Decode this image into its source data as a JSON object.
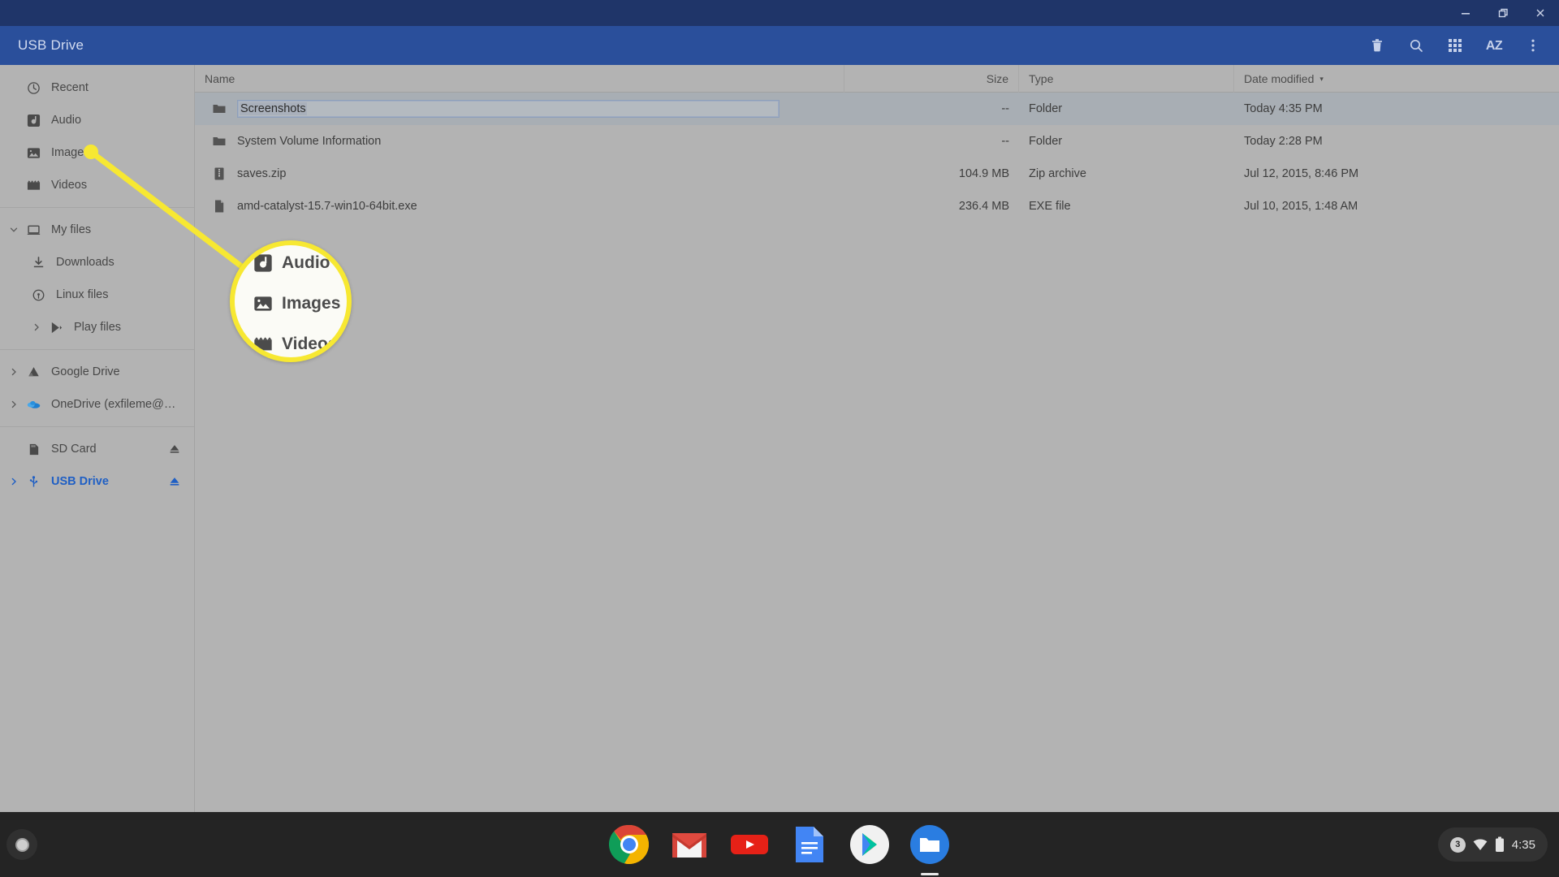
{
  "window": {
    "minimize_label": "Minimize",
    "restore_label": "Restore",
    "close_label": "Close"
  },
  "appbar": {
    "title": "USB Drive",
    "actions": [
      {
        "name": "delete-icon",
        "label": "Delete"
      },
      {
        "name": "search-icon",
        "label": "Search"
      },
      {
        "name": "grid-view-icon",
        "label": "Switch to thumbnail view"
      },
      {
        "name": "sort-az-icon",
        "label": "AZ"
      },
      {
        "name": "more-vert-icon",
        "label": "More…"
      }
    ],
    "az_text": "AZ"
  },
  "sidebar": {
    "groups": [
      {
        "items": [
          {
            "label": "Recent",
            "icon": "clock-icon",
            "twisty": "",
            "indent": false,
            "active": false,
            "eject": false
          },
          {
            "label": "Audio",
            "icon": "audio-icon",
            "twisty": "",
            "indent": false,
            "active": false,
            "eject": false
          },
          {
            "label": "Images",
            "icon": "image-icon",
            "twisty": "",
            "indent": false,
            "active": false,
            "eject": false
          },
          {
            "label": "Videos",
            "icon": "video-icon",
            "twisty": "",
            "indent": false,
            "active": false,
            "eject": false
          }
        ]
      },
      {
        "items": [
          {
            "label": "My files",
            "icon": "computer-icon",
            "twisty": "down",
            "indent": false,
            "active": false,
            "eject": false
          },
          {
            "label": "Downloads",
            "icon": "download-icon",
            "twisty": "",
            "indent": true,
            "active": false,
            "eject": false
          },
          {
            "label": "Linux files",
            "icon": "linux-icon",
            "twisty": "",
            "indent": true,
            "active": false,
            "eject": false
          },
          {
            "label": "Play files",
            "icon": "play-icon",
            "twisty": "right",
            "indent": true,
            "active": false,
            "eject": false
          }
        ]
      },
      {
        "items": [
          {
            "label": "Google Drive",
            "icon": "google-drive-icon",
            "twisty": "right",
            "indent": false,
            "active": false,
            "eject": false
          },
          {
            "label": "OneDrive (exfileme@outlook…",
            "icon": "onedrive-icon",
            "twisty": "right",
            "indent": false,
            "active": false,
            "eject": false
          }
        ]
      },
      {
        "items": [
          {
            "label": "SD Card",
            "icon": "sd-card-icon",
            "twisty": "",
            "indent": false,
            "active": false,
            "eject": true
          },
          {
            "label": "USB Drive",
            "icon": "usb-icon",
            "twisty": "right",
            "indent": false,
            "active": true,
            "eject": true
          }
        ]
      }
    ]
  },
  "filelist": {
    "columns": [
      {
        "key": "name",
        "label": "Name",
        "sorted": false
      },
      {
        "key": "size",
        "label": "Size",
        "sorted": false
      },
      {
        "key": "type",
        "label": "Type",
        "sorted": false
      },
      {
        "key": "date",
        "label": "Date modified",
        "sorted": true,
        "caret": "▾"
      }
    ],
    "rows": [
      {
        "name": "Screenshots",
        "size": "--",
        "type": "Folder",
        "date": "Today 4:35 PM",
        "icon": "folder-icon",
        "selected": true,
        "renaming": true
      },
      {
        "name": "System Volume Information",
        "size": "--",
        "type": "Folder",
        "date": "Today 2:28 PM",
        "icon": "folder-icon",
        "selected": false,
        "renaming": false
      },
      {
        "name": "saves.zip",
        "size": "104.9 MB",
        "type": "Zip archive",
        "date": "Jul 12, 2015, 8:46 PM",
        "icon": "archive-icon",
        "selected": false,
        "renaming": false
      },
      {
        "name": "amd-catalyst-15.7-win10-64bit.exe",
        "size": "236.4 MB",
        "type": "EXE file",
        "date": "Jul 10, 2015, 1:48 AM",
        "icon": "file-icon",
        "selected": false,
        "renaming": false
      }
    ]
  },
  "callout": {
    "highlight_color": "#f7e832",
    "rows": [
      {
        "label": "Audio",
        "icon": "audio-icon"
      },
      {
        "label": "Images",
        "icon": "image-icon"
      },
      {
        "label": "Videos",
        "icon": "video-icon"
      }
    ]
  },
  "shelf": {
    "launcher_label": "Launcher",
    "apps": [
      {
        "name": "chrome-icon",
        "label": "Chrome",
        "active": false
      },
      {
        "name": "gmail-icon",
        "label": "Gmail",
        "active": false
      },
      {
        "name": "youtube-icon",
        "label": "YouTube",
        "active": false
      },
      {
        "name": "google-docs-icon",
        "label": "Docs",
        "active": false
      },
      {
        "name": "play-store-icon",
        "label": "Play Store",
        "active": false
      },
      {
        "name": "files-icon",
        "label": "Files",
        "active": true
      }
    ],
    "tray": {
      "notification_count": "3",
      "wifi_label": "Wi-Fi",
      "battery_label": "Battery",
      "time": "4:35"
    }
  },
  "colors": {
    "titlebar": "#1f3569",
    "appbar": "#2a4f9b",
    "body": "#b3b3b3",
    "accent": "#1f5fc4",
    "selection": "#a8aeb4",
    "shelf": "#242424"
  }
}
